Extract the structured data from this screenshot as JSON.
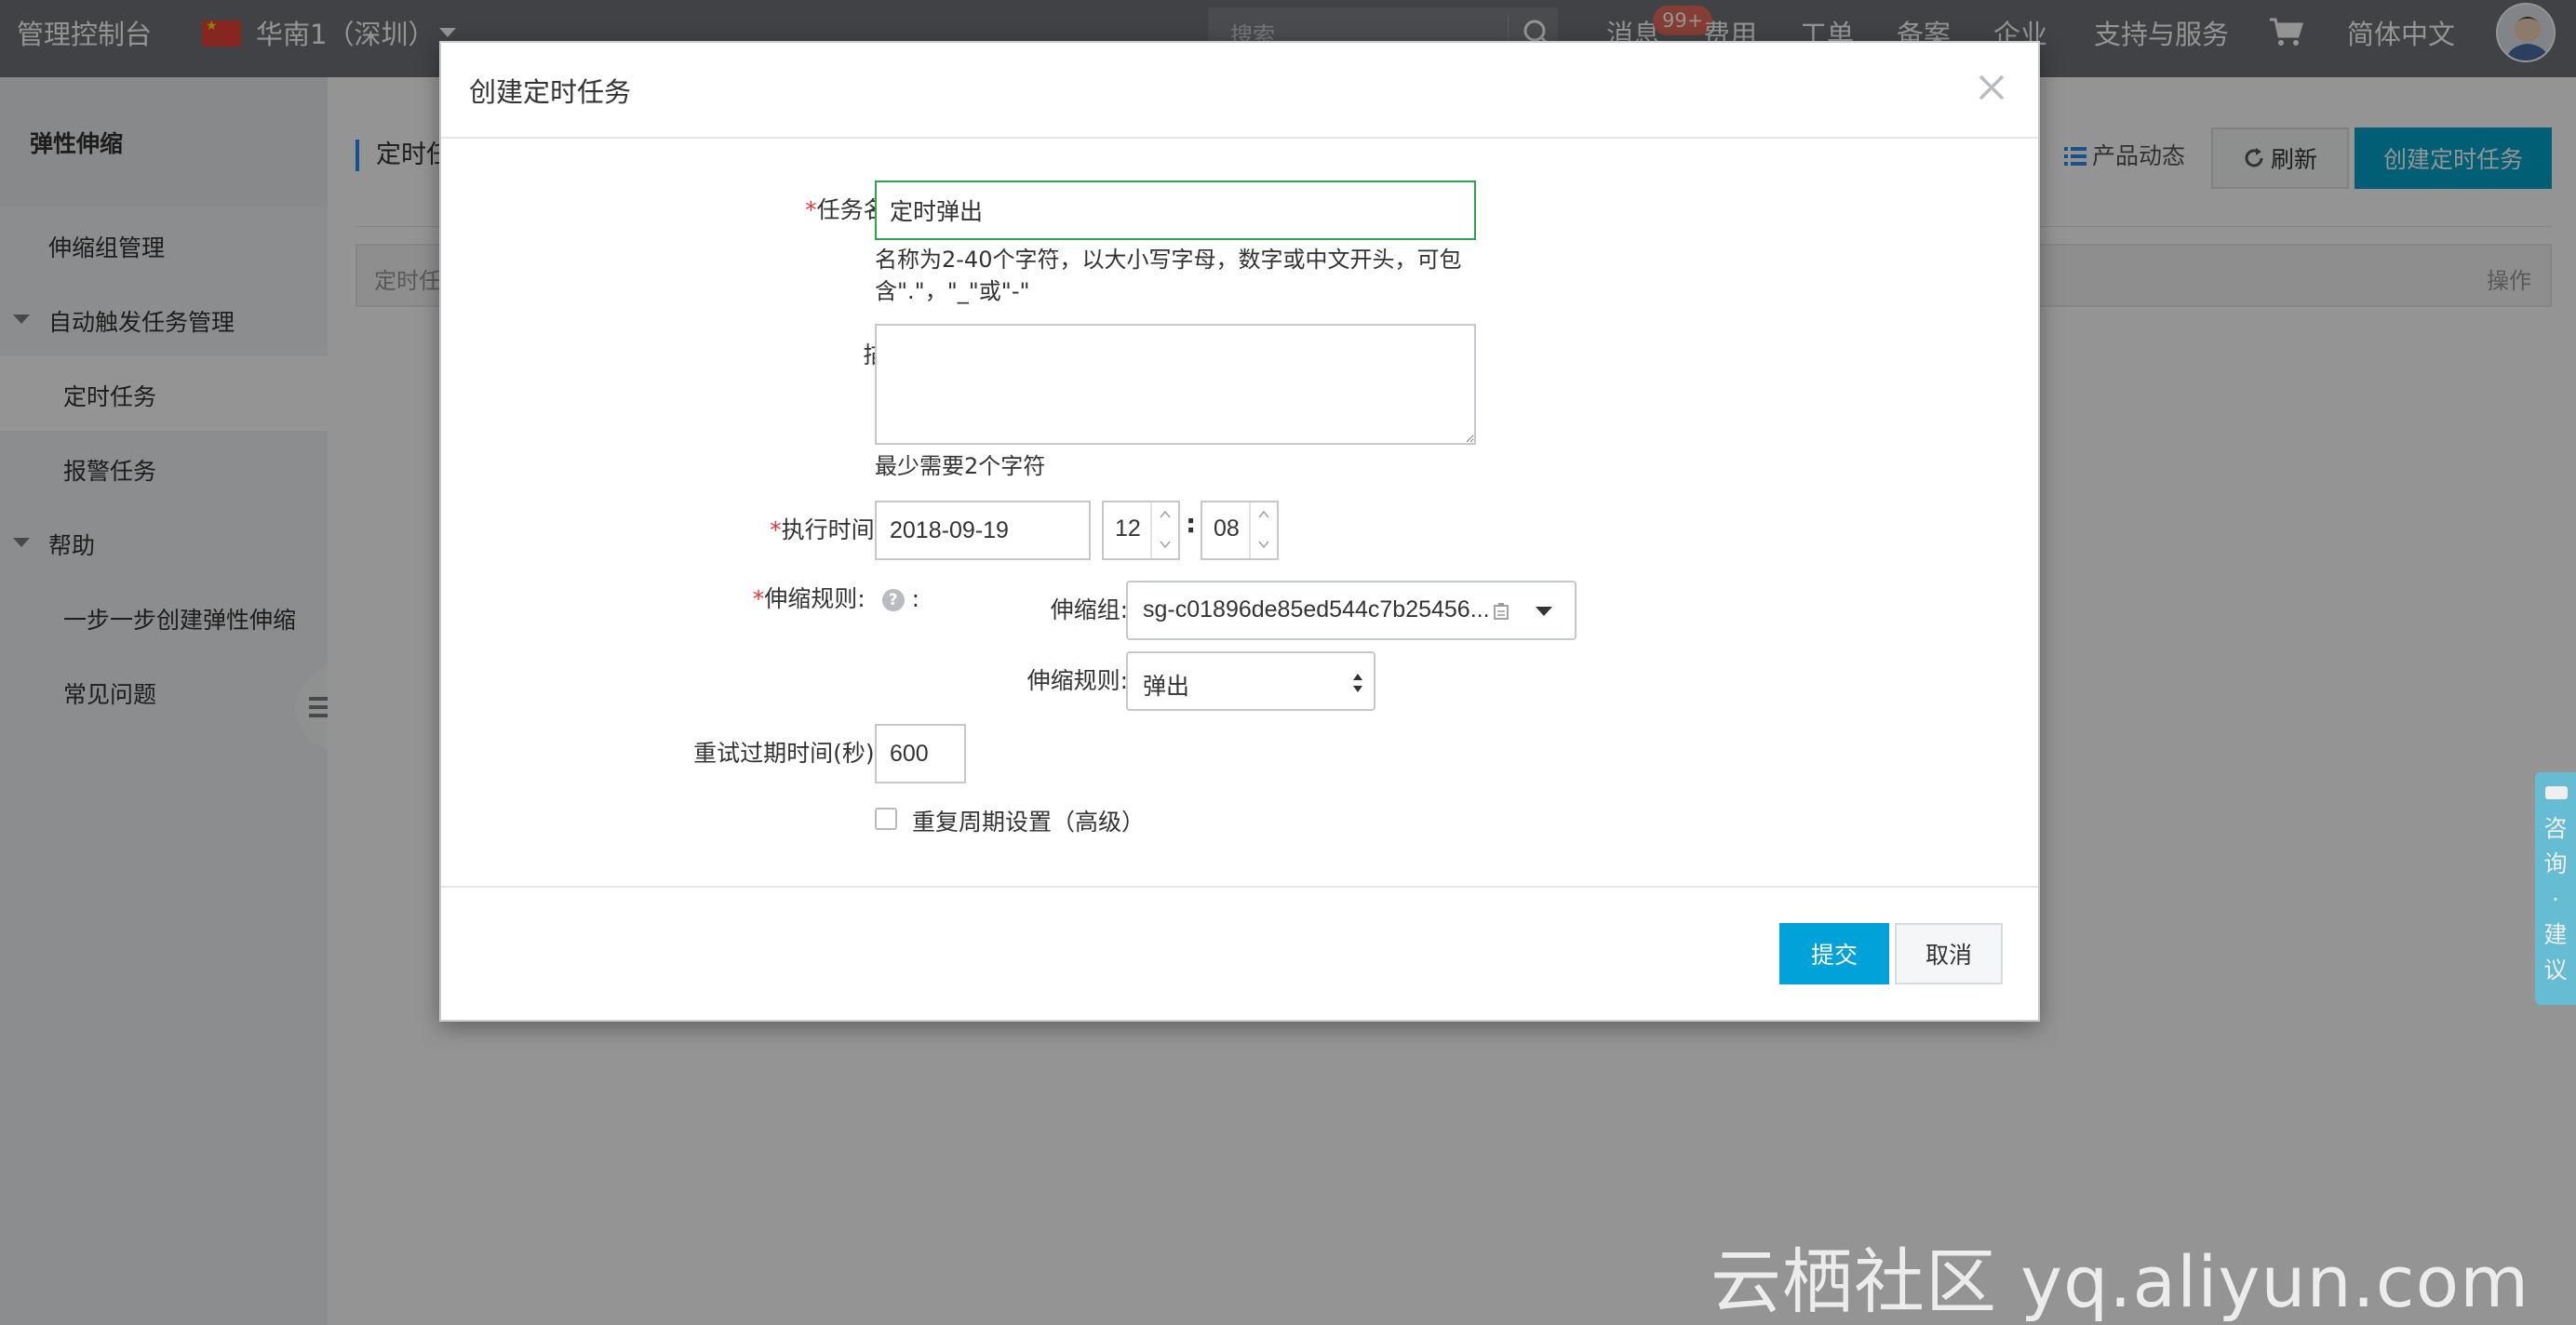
{
  "topbar": {
    "brand": "管理控制台",
    "region": "华南1（深圳）",
    "search_placeholder": "搜索",
    "nav": {
      "messages": "消息",
      "messages_badge": "99+",
      "billing": "费用",
      "tickets": "工单",
      "icp": "备案",
      "enterprise": "企业",
      "support": "支持与服务",
      "language": "简体中文"
    }
  },
  "sidebar": {
    "title": "弹性伸缩",
    "items": [
      {
        "label": "伸缩组管理"
      },
      {
        "label": "自动触发任务管理"
      },
      {
        "label": "定时任务"
      },
      {
        "label": "报警任务"
      },
      {
        "label": "帮助"
      },
      {
        "label": "一步一步创建弹性伸缩"
      },
      {
        "label": "常见问题"
      }
    ]
  },
  "page": {
    "title": "定时任",
    "product_news": "产品动态",
    "refresh": "刷新",
    "create_task": "创建定时任务",
    "table_head_left": "定时任",
    "table_head_right": "操作"
  },
  "modal": {
    "title": "创建定时任务",
    "task_name_label": "任务名称:",
    "task_name_value": "定时弹出",
    "task_name_hint": "名称为2-40个字符，以大小写字母，数字或中文开头，可包含\".\"，\"_\"或\"-\"",
    "description_label": "描述:",
    "description_value": "",
    "description_hint": "最少需要2个字符",
    "exec_time_label": "执行时间",
    "exec_date": "2018-09-19",
    "exec_hour": "12",
    "exec_minute": "08",
    "rule_label": "伸缩规则:",
    "group_label": "伸缩组:",
    "group_value": "sg-c01896de85ed544c7b25456...",
    "rule_select_label": "伸缩规则:",
    "rule_select_value": "弹出",
    "retry_label": "重试过期时间(秒)",
    "retry_value": "600",
    "repeat_label": "重复周期设置（高级）",
    "submit": "提交",
    "cancel": "取消"
  },
  "feedback": "咨询·建议",
  "watermark": "云栖社区 yq.aliyun.com",
  "colors": {
    "topbar": "#6f7378",
    "primary": "#00a2d9",
    "focus_border": "#2fa44f",
    "required": "#e4393c"
  }
}
